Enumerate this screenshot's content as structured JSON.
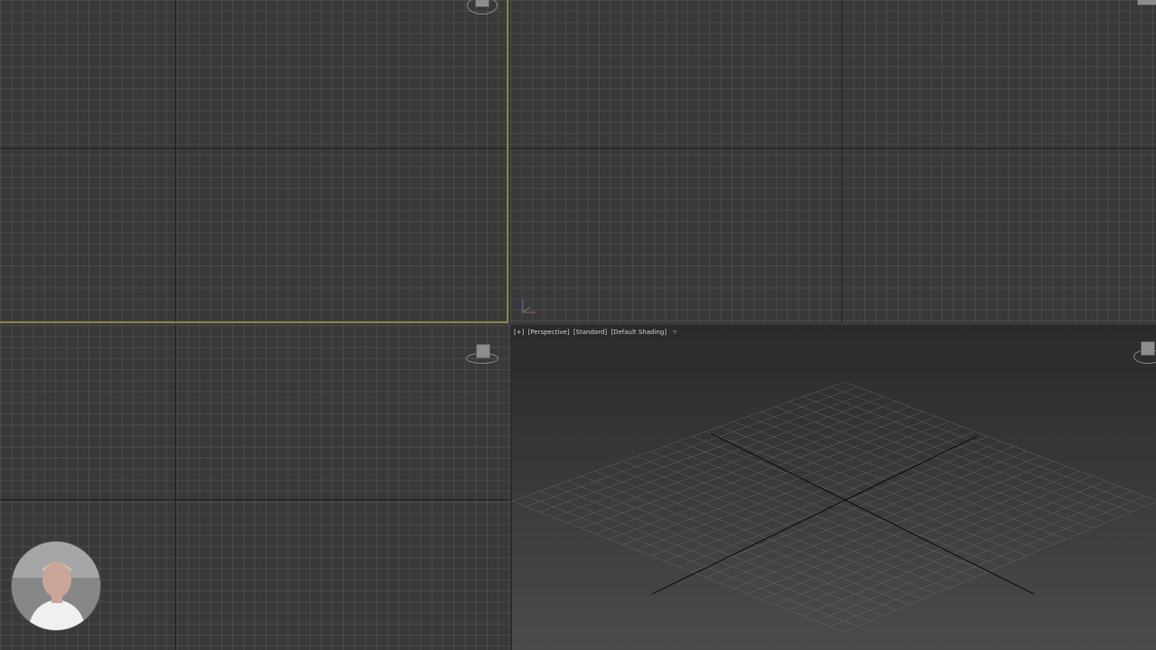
{
  "viewports": {
    "top": {},
    "front": {},
    "left": {},
    "perspective": {
      "label_parts": [
        "[+]",
        "[Perspective]",
        "[Standard]",
        "[Default Shading]"
      ],
      "filter_icon": "filter-icon"
    }
  },
  "colors": {
    "active_viewport_border": "#8a8246",
    "grid_background": "#393939",
    "perspective_top": "#2a2a2a",
    "perspective_bottom": "#4b4b4b"
  },
  "icons": [
    "viewcube-icon",
    "filter-icon",
    "axis-tripod-icon"
  ]
}
